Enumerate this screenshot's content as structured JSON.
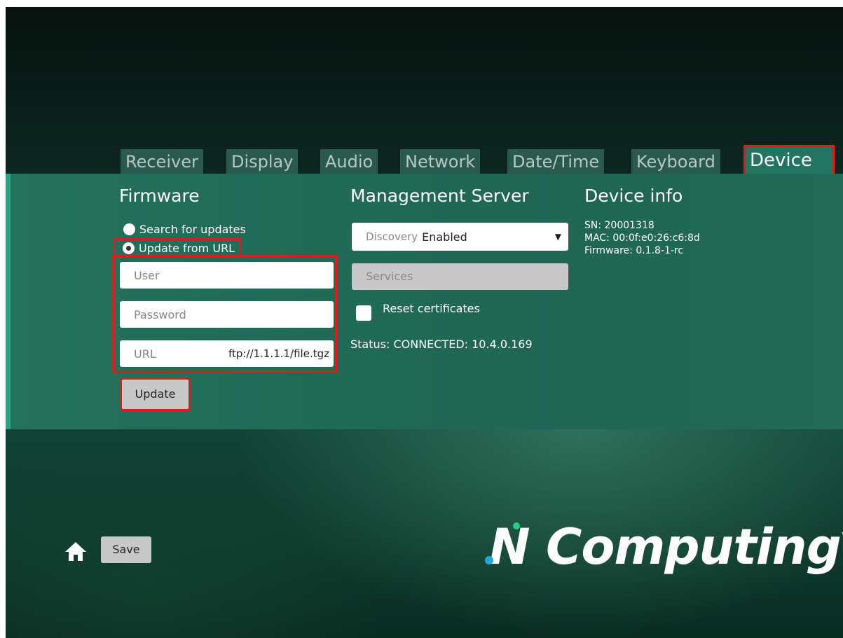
{
  "tabs": [
    {
      "label": "Receiver"
    },
    {
      "label": "Display"
    },
    {
      "label": "Audio"
    },
    {
      "label": "Network"
    },
    {
      "label": "Date/Time"
    },
    {
      "label": "Keyboard"
    },
    {
      "label": "Device",
      "active": true
    }
  ],
  "firmware": {
    "title": "Firmware",
    "option_search": "Search for updates",
    "option_url": "Update from URL",
    "selected_option": "Update from URL",
    "user_placeholder": "User",
    "password_placeholder": "Password",
    "url_placeholder": "URL",
    "url_value": "ftp://1.1.1.1/file.tgz",
    "update_button": "Update"
  },
  "management": {
    "title": "Management Server",
    "discovery_label": "Discovery",
    "discovery_value": "Enabled",
    "services_button": "Services",
    "reset_certificates_label": "Reset certificates",
    "reset_certificates_checked": false,
    "status_text": "Status: CONNECTED: 10.4.0.169"
  },
  "device_info": {
    "title": "Device info",
    "sn": "SN: 20001318",
    "mac": "MAC: 00:0f:e0:26:c6:8d",
    "firmware": "Firmware: 0.1.8-1-rc"
  },
  "footer": {
    "save_button": "Save",
    "logo_text_n": "N",
    "logo_text_rest": "Computing",
    "logo_tm": "™"
  },
  "colors": {
    "highlight": "#e01b1b",
    "panel": "#22705b",
    "logo_accent": "#21d37f"
  },
  "icons": {
    "home": "home-icon",
    "dropdown": "triangle-down-icon"
  }
}
